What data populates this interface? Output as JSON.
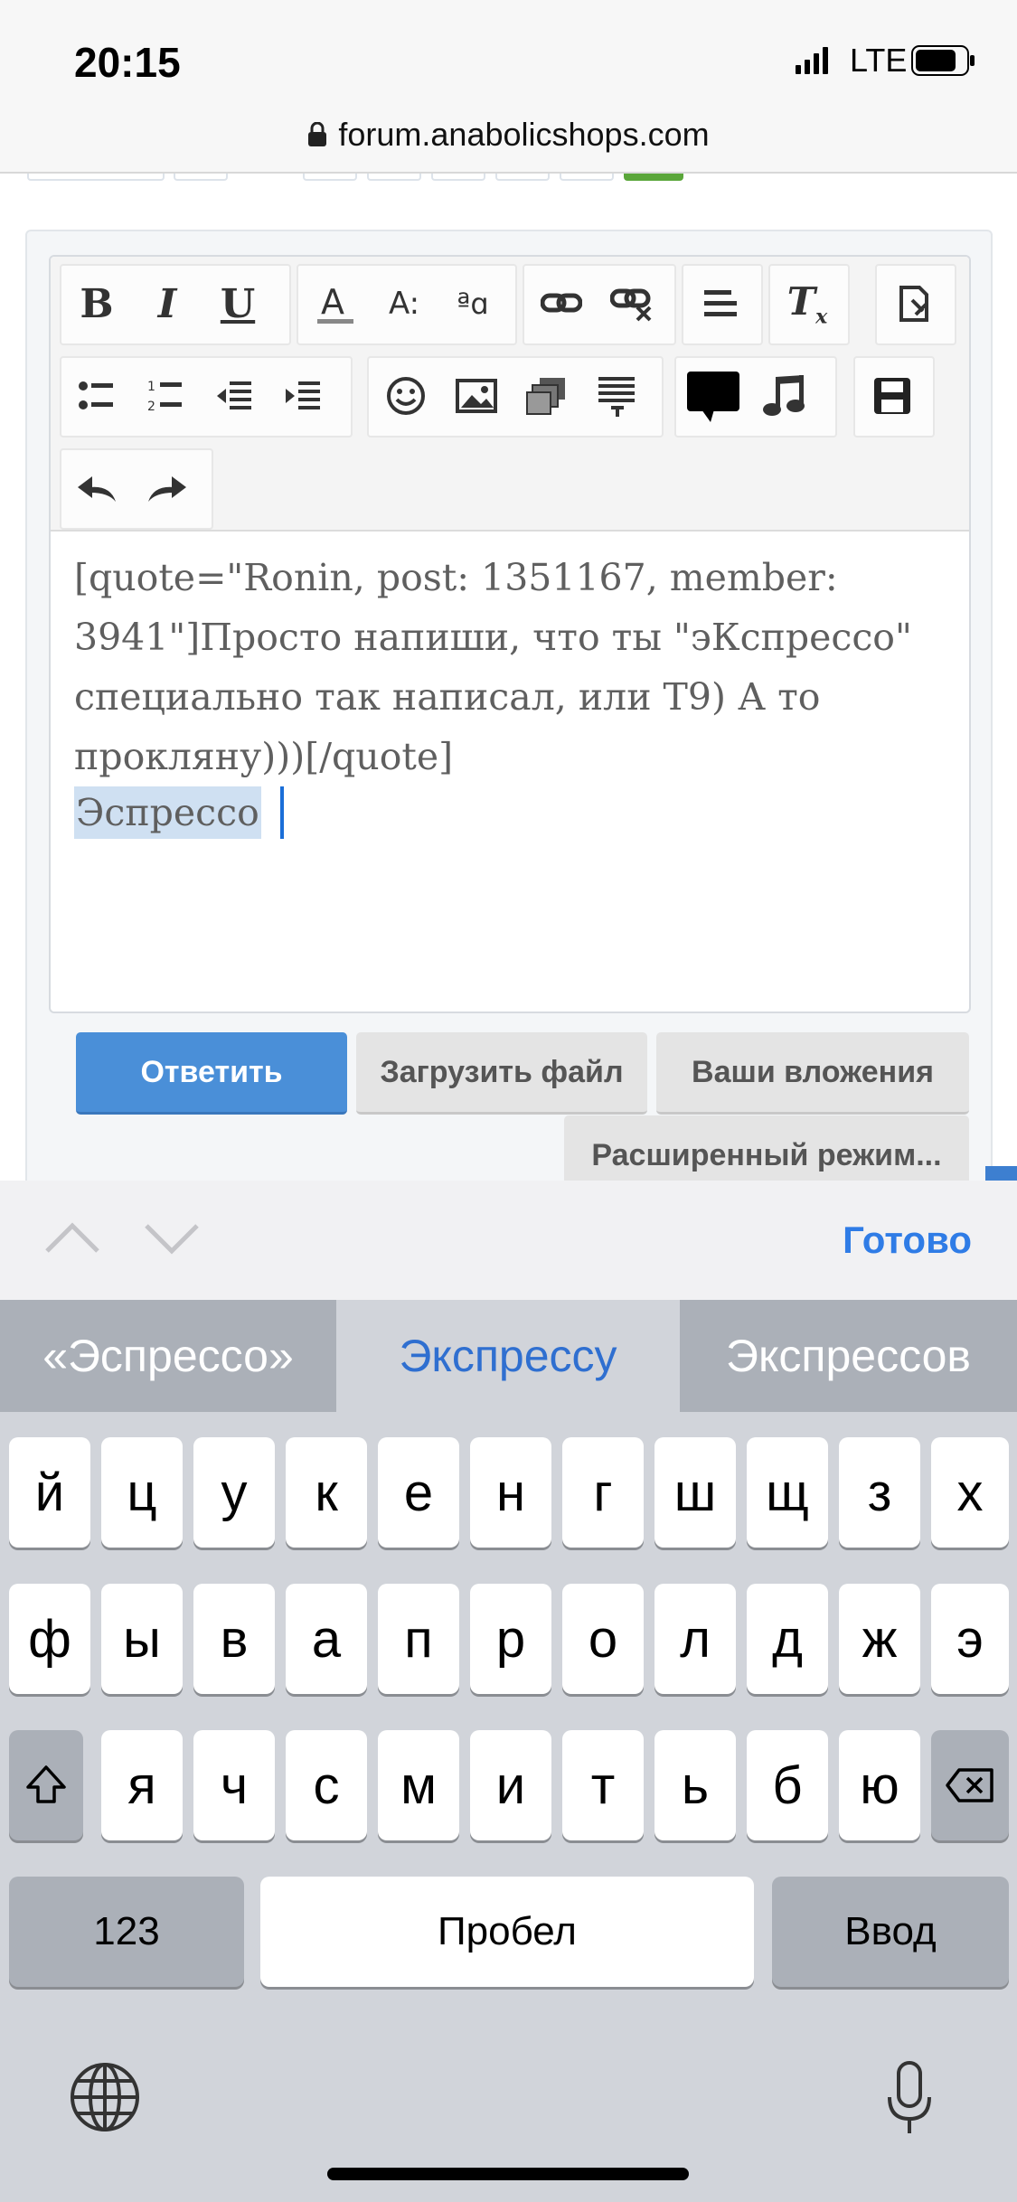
{
  "status_bar": {
    "time": "20:15",
    "carrier": "LTE"
  },
  "browser": {
    "url": "forum.anabolicshops.com"
  },
  "editor": {
    "quote_text": "[quote=\"Ronin, post: 1351167, member: 3941\"]Просто напиши, что ты \"эКспрессо\" специально так написал, или Т9) А то прокляну)))[/quote]",
    "typed_text": "Эспрессо"
  },
  "buttons": {
    "reply": "Ответить",
    "upload": "Загрузить файл",
    "attachments": "Ваши вложения",
    "advanced": "Расширенный режим..."
  },
  "accessory_bar": {
    "done": "Готово"
  },
  "suggestions": [
    "«Эспрессо»",
    "Экспрессу",
    "Экспрессов"
  ],
  "keyboard": {
    "row1": [
      "й",
      "ц",
      "у",
      "к",
      "е",
      "н",
      "г",
      "ш",
      "щ",
      "з",
      "х"
    ],
    "row2": [
      "ф",
      "ы",
      "в",
      "а",
      "п",
      "р",
      "о",
      "л",
      "д",
      "ж",
      "э"
    ],
    "row3": [
      "я",
      "ч",
      "с",
      "м",
      "и",
      "т",
      "ь",
      "б",
      "ю"
    ],
    "numbers_key": "123",
    "space_key": "Пробел",
    "return_key": "Ввод"
  },
  "colors": {
    "accent": "#2f7ce6",
    "reply_button": "#4a8fd8",
    "selection": "#cfe0f2"
  }
}
